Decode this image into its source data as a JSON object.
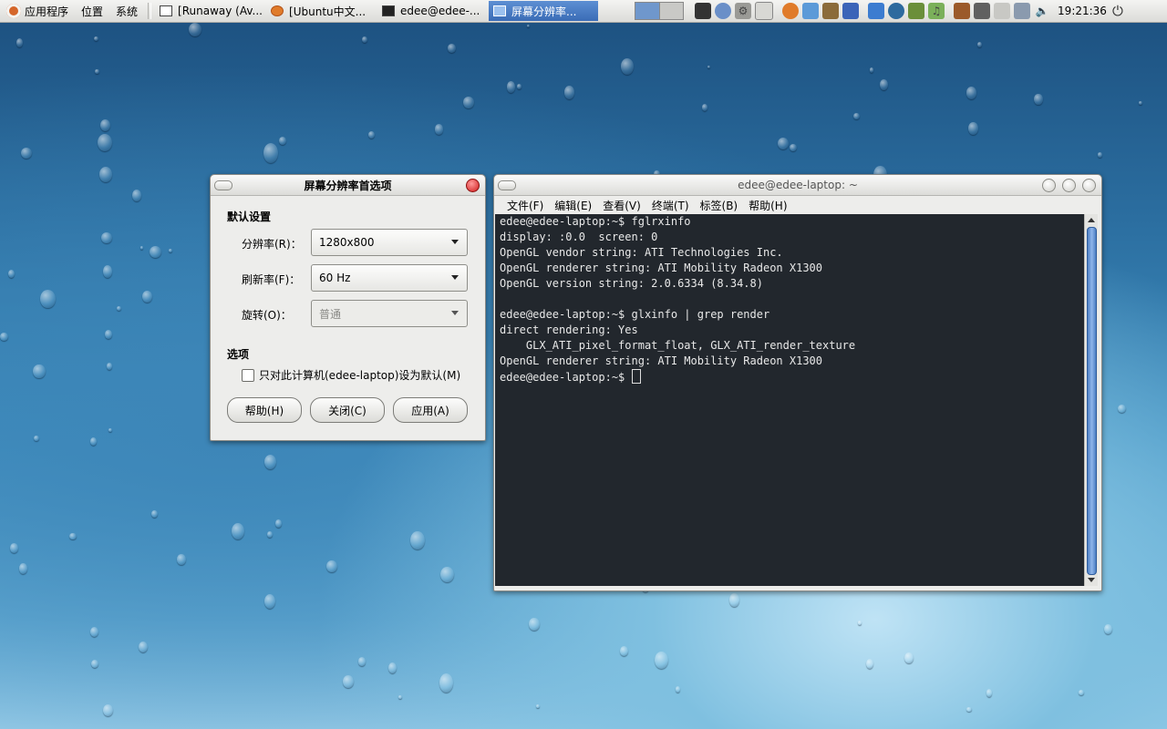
{
  "panel": {
    "menus": [
      "应用程序",
      "位置",
      "系统"
    ],
    "tasks": [
      {
        "label": "[Runaway (Av...",
        "icon": "window-icon"
      },
      {
        "label": "[Ubuntu中文...",
        "icon": "firefox-icon"
      },
      {
        "label": "edee@edee-...",
        "icon": "terminal-icon"
      },
      {
        "label": "屏幕分辨率...",
        "icon": "display-icon"
      }
    ],
    "clock": "19:21:36"
  },
  "res_dialog": {
    "title": "屏幕分辨率首选项",
    "section_default": "默认设置",
    "resolution_label": "分辨率(R)：",
    "resolution_value": "1280x800",
    "refresh_label": "刷新率(F)：",
    "refresh_value": "60 Hz",
    "rotation_label": "旋转(O)：",
    "rotation_value": "普通",
    "section_options": "选项",
    "checkbox_label": "只对此计算机(edee-laptop)设为默认(M)",
    "help_button": "帮助(H)",
    "close_button": "关闭(C)",
    "apply_button": "应用(A)"
  },
  "terminal": {
    "title": "edee@edee-laptop: ~",
    "menus": [
      "文件(F)",
      "编辑(E)",
      "查看(V)",
      "终端(T)",
      "标签(B)",
      "帮助(H)"
    ],
    "lines": [
      "edee@edee-laptop:~$ fglrxinfo",
      "display: :0.0  screen: 0",
      "OpenGL vendor string: ATI Technologies Inc.",
      "OpenGL renderer string: ATI Mobility Radeon X1300",
      "OpenGL version string: 2.0.6334 (8.34.8)",
      "",
      "edee@edee-laptop:~$ glxinfo | grep render",
      "direct rendering: Yes",
      "    GLX_ATI_pixel_format_float, GLX_ATI_render_texture",
      "OpenGL renderer string: ATI Mobility Radeon X1300"
    ],
    "prompt": "edee@edee-laptop:~$ "
  }
}
